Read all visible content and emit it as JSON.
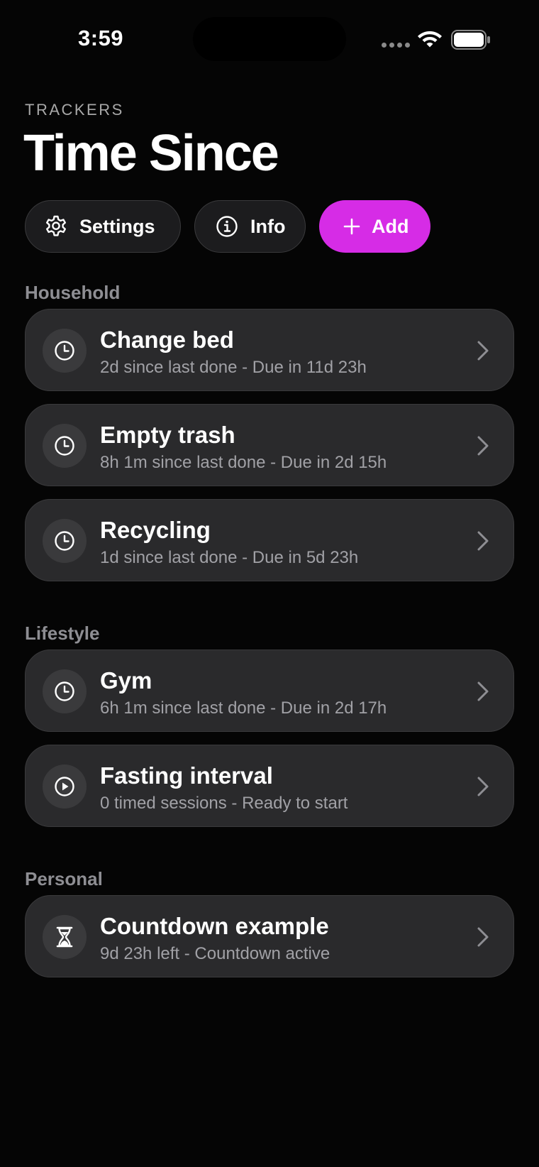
{
  "status_bar": {
    "time": "3:59",
    "icons": [
      "cellular-signal-icon",
      "wifi-icon",
      "battery-icon"
    ]
  },
  "header": {
    "eyebrow": "TRACKERS",
    "title": "Time Since"
  },
  "toolbar": {
    "settings_label": "Settings",
    "info_label": "Info",
    "add_label": "Add",
    "settings_icon": "gear-icon",
    "info_icon": "info-circle-icon",
    "add_icon": "plus-icon"
  },
  "colors": {
    "background": "#050505",
    "card": "#2a2a2c",
    "accent": "#d62ce6",
    "secondary_text": "#a1a1a6",
    "section_header": "#8e8e93"
  },
  "sections": [
    {
      "title": "Household",
      "items": [
        {
          "icon": "clock-icon",
          "title": "Change bed",
          "subtitle": "2d since last done - Due in 11d 23h"
        },
        {
          "icon": "clock-icon",
          "title": "Empty trash",
          "subtitle": "8h 1m since last done - Due in 2d 15h"
        },
        {
          "icon": "clock-icon",
          "title": "Recycling",
          "subtitle": "1d since last done - Due in 5d 23h"
        }
      ]
    },
    {
      "title": "Lifestyle",
      "items": [
        {
          "icon": "clock-icon",
          "title": "Gym",
          "subtitle": "6h 1m since last done - Due in 2d 17h"
        },
        {
          "icon": "play-circle-icon",
          "title": "Fasting interval",
          "subtitle": "0 timed sessions - Ready to start"
        }
      ]
    },
    {
      "title": "Personal",
      "items": [
        {
          "icon": "hourglass-icon",
          "title": "Countdown example",
          "subtitle": "9d 23h left - Countdown active"
        }
      ]
    }
  ]
}
